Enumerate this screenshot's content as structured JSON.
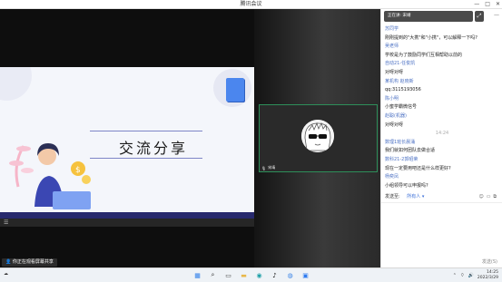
{
  "window": {
    "title": "腾讯会议",
    "controls": [
      "—",
      "□",
      "✕"
    ]
  },
  "slide": {
    "title": "交流分享",
    "colors": {
      "bluebar": "#27296d",
      "sticky": "#4b86ee"
    }
  },
  "video": {
    "name": "宋靖",
    "avatar_alt": "sunglasses-avatar"
  },
  "stage_bar": {
    "menu_icon": "☰"
  },
  "chat": {
    "header": "正在讲: 宋靖",
    "messages": [
      {
        "type": "sender",
        "text": "苏同学"
      },
      {
        "type": "body",
        "text": "刚刚提到的\"大携\"和\"小携\"，可以解释一下吗?"
      },
      {
        "type": "sender",
        "text": "吴老师"
      },
      {
        "type": "body",
        "text": "学校是为了鼓励同学们互相帮助以前的"
      },
      {
        "type": "sender",
        "text": "自动21-任俊凯"
      },
      {
        "type": "body",
        "text": "对呀对呀"
      },
      {
        "type": "sender",
        "text": "某机构 赵晓新"
      },
      {
        "type": "body",
        "text": "qq:3115193056"
      },
      {
        "type": "sender",
        "text": "陈小明"
      },
      {
        "type": "body",
        "text": "小蜜学霸微信号"
      },
      {
        "type": "sender",
        "text": "赵聪(机器)"
      },
      {
        "type": "body",
        "text": "对呀对呀"
      },
      {
        "type": "time",
        "text": "14:24"
      },
      {
        "type": "sender",
        "text": "数理1班长晨涌"
      },
      {
        "type": "body",
        "text": "我们就如何团队去做合适"
      },
      {
        "type": "sender",
        "text": "数科21-2郭昭荣"
      },
      {
        "type": "body",
        "text": "现在一定要用吧还是什么样更好?"
      },
      {
        "type": "sender",
        "text": "杨奕凤"
      },
      {
        "type": "body",
        "text": "小组领导可以申报吗?"
      }
    ],
    "to_label": "发送至:",
    "to_value": "所有人 ▾",
    "send_label": "发送(S)"
  },
  "status": {
    "share_text": "你正在观看屏幕共享"
  },
  "taskbar": {
    "weather": "☁",
    "apps": [
      {
        "name": "windows-start",
        "glyph": "▦",
        "color": "#2b7de9"
      },
      {
        "name": "search",
        "glyph": "⌕",
        "color": "#333333"
      },
      {
        "name": "task-view",
        "glyph": "▭",
        "color": "#444444"
      },
      {
        "name": "file-explorer",
        "glyph": "▬",
        "color": "#e8b84a"
      },
      {
        "name": "edge",
        "glyph": "◉",
        "color": "#1fa0a8"
      },
      {
        "name": "tiktok",
        "glyph": "♪",
        "color": "#111111"
      },
      {
        "name": "app-blue",
        "glyph": "◍",
        "color": "#3b84e6"
      },
      {
        "name": "tencent-meeting",
        "glyph": "▣",
        "color": "#2f7cf0"
      }
    ],
    "clock_time": "14:25",
    "clock_date": "2022/3/29"
  }
}
